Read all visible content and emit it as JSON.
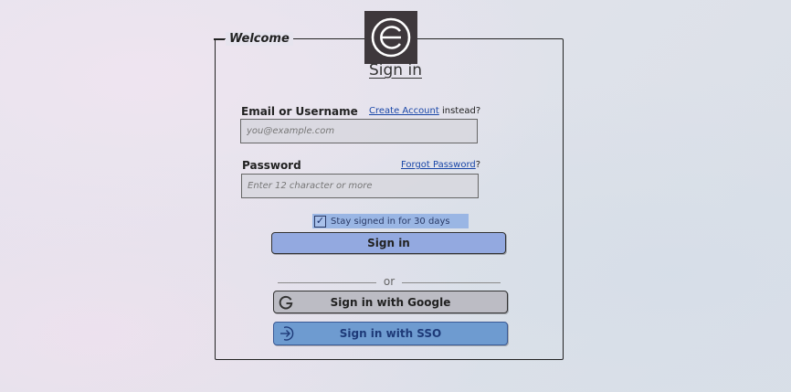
{
  "form": {
    "legend": "Welcome",
    "title": "Sign in",
    "logo_icon": "circle-e-logo-icon"
  },
  "email": {
    "label": "Email or Username",
    "create_account_link": "Create Account",
    "create_account_suffix": " instead?",
    "placeholder": "you@example.com",
    "value": ""
  },
  "password": {
    "label": "Password",
    "forgot_link": "Forgot Password",
    "forgot_suffix": "?",
    "placeholder": "Enter 12 character or more",
    "value": ""
  },
  "remember": {
    "label": "Stay signed in for 30 days",
    "checked": true,
    "check_glyph": "✓"
  },
  "actions": {
    "signin_label": "Sign in",
    "divider_label": "or",
    "google_label": "Sign in with Google",
    "google_icon": "google-g-icon",
    "sso_label": "Sign in with SSO",
    "sso_icon": "arrow-in-circle-icon"
  },
  "colors": {
    "signin_button": "#93a9e0",
    "google_button": "#bcbcc4",
    "sso_button": "#6e9bd0",
    "checkbox_highlight": "#9ab6e4",
    "link": "#1a47a8",
    "logo_bg": "#3e383c"
  }
}
